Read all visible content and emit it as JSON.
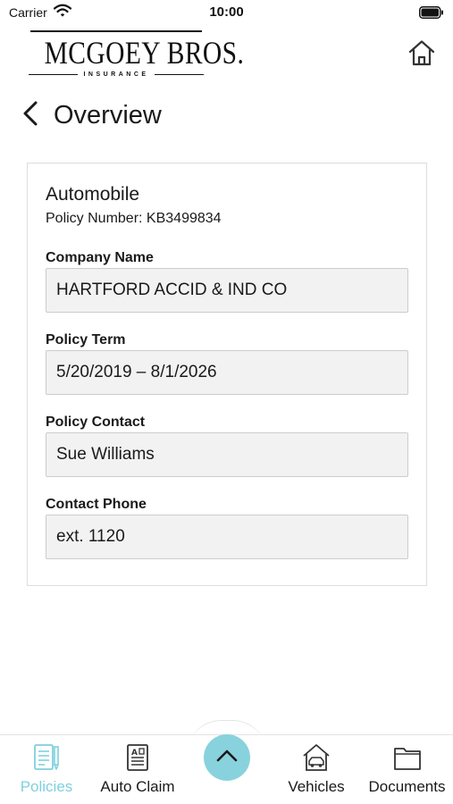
{
  "status_bar": {
    "carrier": "Carrier",
    "time": "10:00"
  },
  "logo": {
    "name": "MCGOEY BROS.",
    "subtitle": "INSURANCE"
  },
  "header": {
    "title": "Overview"
  },
  "policy": {
    "type": "Automobile",
    "number_text": "Policy Number: KB3499834",
    "fields": [
      {
        "label": "Company Name",
        "value": "HARTFORD ACCID & IND CO"
      },
      {
        "label": "Policy Term",
        "value": "5/20/2019 – 8/1/2026"
      },
      {
        "label": "Policy Contact",
        "value": "Sue Williams"
      },
      {
        "label": "Contact Phone",
        "value": "ext. 1120"
      }
    ]
  },
  "tabs": [
    {
      "label": "Policies",
      "icon": "policies-icon",
      "active": true
    },
    {
      "label": "Auto Claim",
      "icon": "auto-claim-icon",
      "active": false
    },
    {
      "label": "Vehicles",
      "icon": "vehicles-icon",
      "active": false
    },
    {
      "label": "Documents",
      "icon": "documents-icon",
      "active": false
    }
  ],
  "colors": {
    "accent": "#88d2dd",
    "active_tab": "#7fd0de",
    "field_background": "#f2f2f2"
  }
}
